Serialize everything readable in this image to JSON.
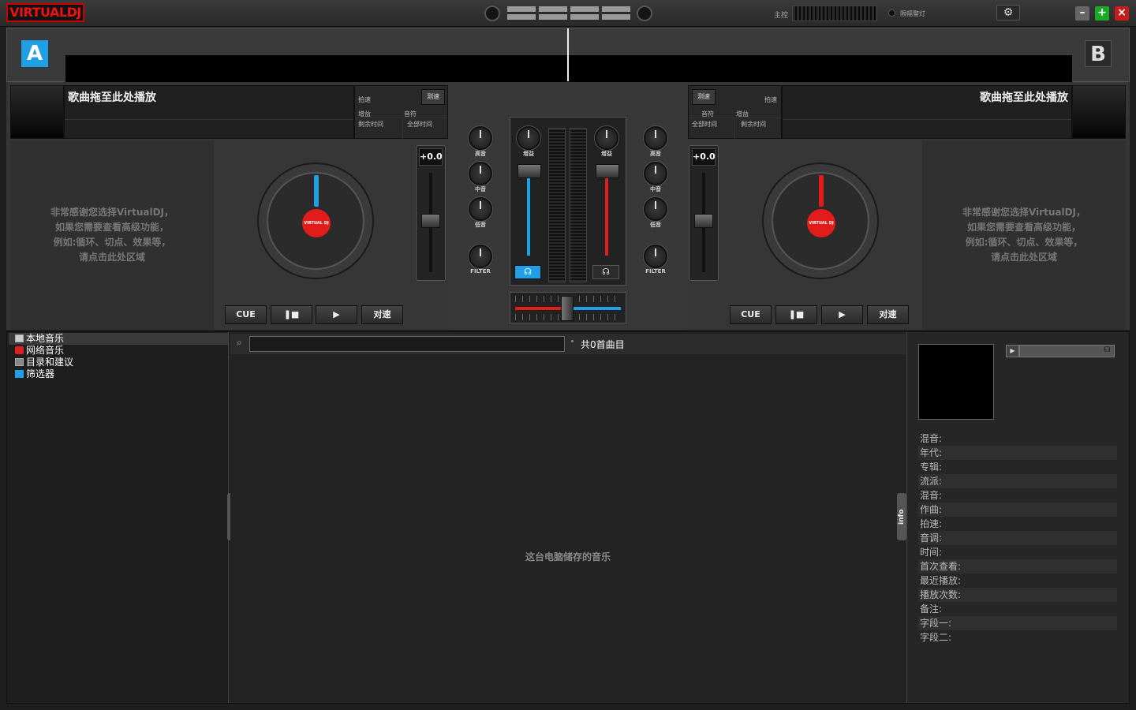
{
  "app": {
    "logo": "VIRTUALDJ"
  },
  "topbar": {
    "master_label": "主控",
    "limiter_label": "限幅警灯",
    "settings_icon": "gear-icon",
    "min_label": "–",
    "max_label": "+",
    "close_label": "×"
  },
  "deck_a": {
    "badge": "A",
    "title": "歌曲拖至此处播放",
    "bpm_label": "拍速",
    "tap_label": "测速",
    "gain_label": "增益",
    "key_label": "音符",
    "remain_label": "剩余时间",
    "total_label": "全部时间",
    "ad": [
      "非常感谢您选择VirtualDJ，",
      "如果您需要查看高级功能，",
      "例如:循环、切点、效果等，",
      "请点击此处区域"
    ],
    "pitch": "+0.0",
    "cue": "CUE",
    "pause_icon": "pause-icon",
    "play_icon": "play-icon",
    "sync": "对速",
    "accent": "#1fa0e6"
  },
  "deck_b": {
    "badge": "B",
    "title": "歌曲拖至此处播放",
    "bpm_label": "拍速",
    "tap_label": "测速",
    "gain_label": "增益",
    "key_label": "音符",
    "remain_label": "剩余时间",
    "total_label": "全部时间",
    "ad": [
      "非常感谢您选择VirtualDJ，",
      "如果您需要查看高级功能，",
      "例如:循环、切点、效果等，",
      "请点击此处区域"
    ],
    "pitch": "+0.0",
    "cue": "CUE",
    "pause_icon": "pause-icon",
    "play_icon": "play-icon",
    "sync": "对速",
    "accent": "#e21b1b"
  },
  "mixer": {
    "high": "高音",
    "mid": "中音",
    "low": "低音",
    "filter": "FILTER",
    "gain": "增益",
    "headphone_icon": "headphone-icon"
  },
  "platter_logo": "VIRTUAL DJ",
  "browser": {
    "tree": [
      "本地音乐",
      "网络音乐",
      "目录和建议",
      "筛选器"
    ],
    "search_placeholder": "",
    "count": "共0首曲目",
    "empty_text": "这台电脑储存的音乐",
    "folders_tab": "folders",
    "info_tab": "info"
  },
  "info_fields": [
    "混音:",
    "年代:",
    "专辑:",
    "流派:",
    "混音:",
    "作曲:",
    "拍速:",
    "音调:",
    "时间:",
    "首次查看:",
    "最近播放:",
    "播放次数:",
    "备注:",
    "字段一:",
    "字段二:"
  ]
}
